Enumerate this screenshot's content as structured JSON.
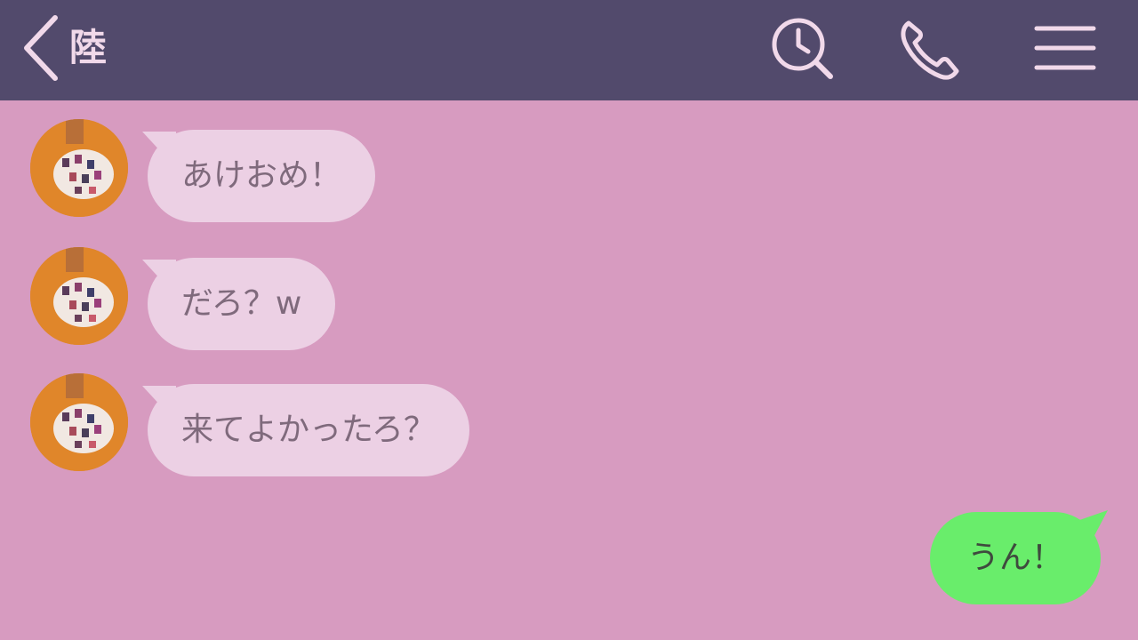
{
  "header": {
    "title": "陸",
    "icons": [
      "back-chevron-icon",
      "clock-search-icon",
      "phone-icon",
      "hamburger-menu-icon"
    ],
    "bg_color": "#524a6c",
    "icon_color": "#f1d9ea"
  },
  "chat": {
    "bg_color": "#d79bc0",
    "incoming": [
      {
        "text": "あけおめ！"
      },
      {
        "text": "だろ？w"
      },
      {
        "text": "来てよかったろ？"
      }
    ],
    "incoming_bubble_color": "#ecd0e4",
    "outgoing": [
      {
        "text": "うん！"
      }
    ],
    "outgoing_bubble_color": "#69ed6b"
  }
}
